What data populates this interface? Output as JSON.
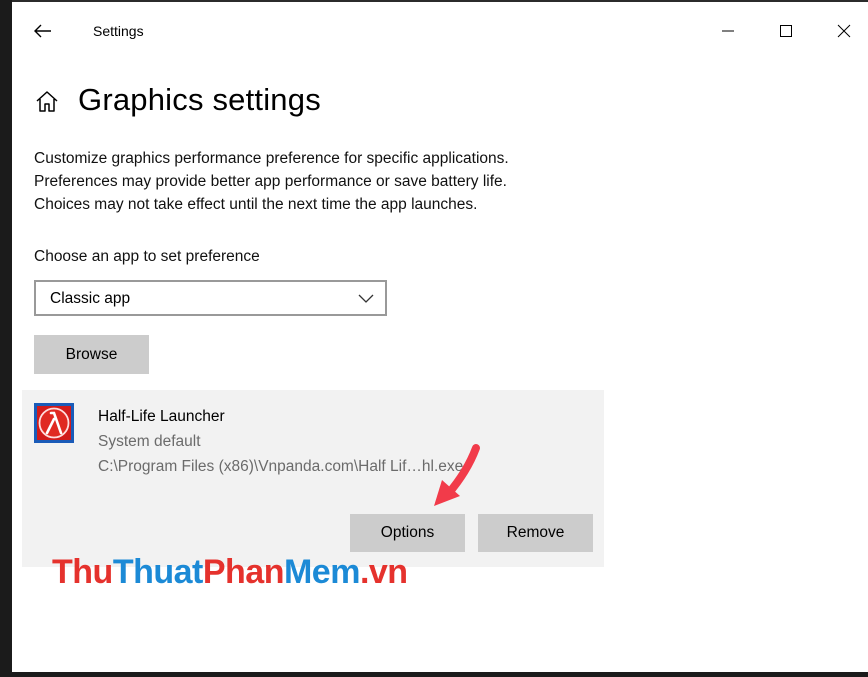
{
  "window": {
    "title": "Settings",
    "buttons": [
      "minimize",
      "maximize",
      "close"
    ]
  },
  "page": {
    "heading": "Graphics settings",
    "description": [
      "Customize graphics performance preference for specific applications.",
      "Preferences may provide better app performance or save battery life.",
      "Choices may not take effect until the next time the app launches."
    ],
    "choose_label": "Choose an app to set preference",
    "app_type": {
      "selected": "Classic app"
    },
    "browse_label": "Browse"
  },
  "app": {
    "name": "Half-Life Launcher",
    "preference": "System default",
    "path": "C:\\Program Files (x86)\\Vnpanda.com\\Half Lif…hl.exe",
    "options_label": "Options",
    "remove_label": "Remove"
  },
  "watermark": {
    "part_red_1": "Thu",
    "part_blue_1": "Thuat",
    "part_red_2": "Phan",
    "part_blue_2": "Mem",
    "part_red_3": ".vn"
  },
  "colors": {
    "accent_arrow": "#f23b4a",
    "button_gray": "#cccccc",
    "card_bg": "#f2f2f2",
    "secondary_text": "#6b6b6b",
    "watermark_red": "#e5322d",
    "watermark_blue": "#1c8ad6"
  },
  "icons": {
    "back": "back-arrow-icon",
    "home": "home-icon",
    "minimize": "minimize-icon",
    "maximize": "maximize-icon",
    "close": "close-icon",
    "dropdown": "chevron-down-icon",
    "app": "half-life-lambda-icon"
  }
}
